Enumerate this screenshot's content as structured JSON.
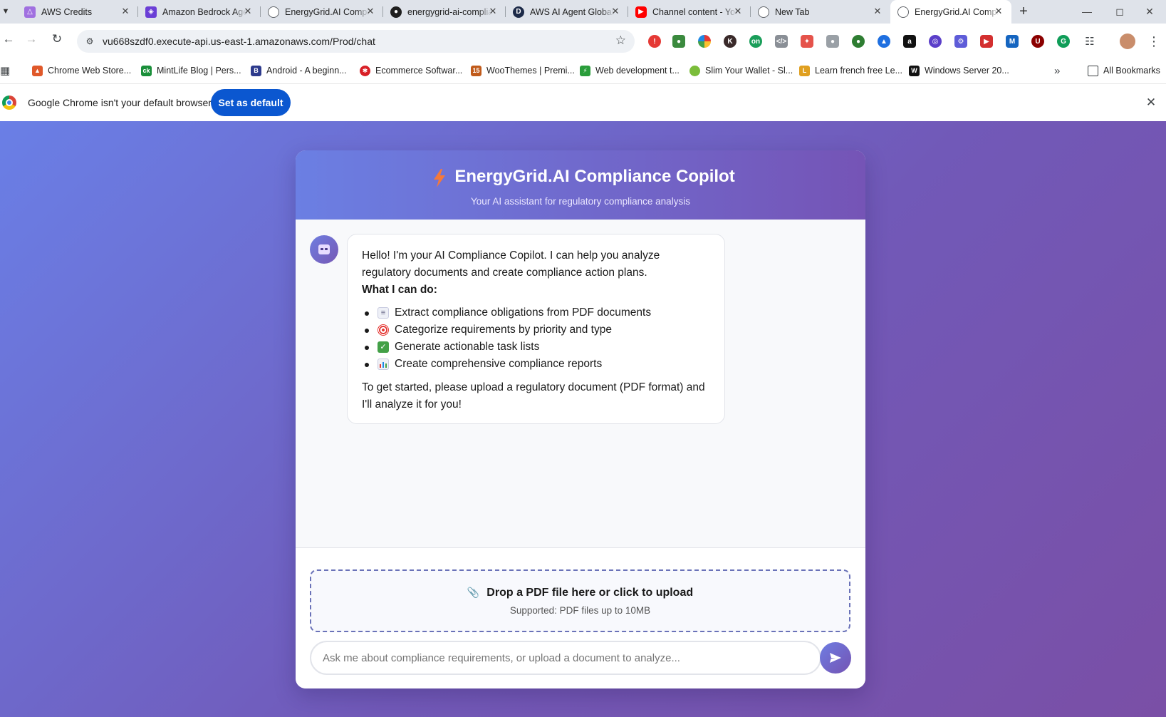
{
  "browser": {
    "tabs": [
      {
        "title": "AWS Credits",
        "favicon": "aws-cube-icon",
        "color": "#a070e0"
      },
      {
        "title": "Amazon Bedrock Agents",
        "favicon": "bedrock-icon",
        "color": "#6b3fd6"
      },
      {
        "title": "EnergyGrid.AI Compliance",
        "favicon": "globe-icon",
        "color": "#5f6368"
      },
      {
        "title": "energygrid-ai-compliance",
        "favicon": "github-icon",
        "color": "#1f1f1f"
      },
      {
        "title": "AWS AI Agent Global",
        "favicon": "d-logo-icon",
        "color": "#1c2a48"
      },
      {
        "title": "Channel content - YouTube",
        "favicon": "youtube-icon",
        "color": "#ff0000"
      },
      {
        "title": "New Tab",
        "favicon": "chrome-icon",
        "color": "#5f6368"
      },
      {
        "title": "EnergyGrid.AI Compliance",
        "favicon": "globe-icon",
        "color": "#5f6368"
      }
    ],
    "active_tab": 7,
    "url": "vu668szdf0.execute-api.us-east-1.amazonaws.com/Prod/chat",
    "bookmarks": [
      {
        "label": "Chrome Web Store...",
        "icon": "webstore-icon",
        "color": "#e0592a"
      },
      {
        "label": "MintLife Blog | Pers...",
        "icon": "ck-icon",
        "color": "#1a8f3a"
      },
      {
        "label": "Android - A beginn...",
        "icon": "b-icon",
        "color": "#2d3a8c"
      },
      {
        "label": "Ecommerce Softwar...",
        "icon": "ecommerce-icon",
        "color": "#d81f26"
      },
      {
        "label": "WooThemes | Premi...",
        "icon": "woo-icon",
        "color": "#c05a1a"
      },
      {
        "label": "Web development t...",
        "icon": "webdev-icon",
        "color": "#2a9d3b"
      },
      {
        "label": "Slim Your Wallet - Sl...",
        "icon": "leaf-icon",
        "color": "#7bbd3a"
      },
      {
        "label": "Learn french free Le...",
        "icon": "lsf-icon",
        "color": "#e0a020"
      },
      {
        "label": "Windows Server 20...",
        "icon": "w-icon",
        "color": "#111111"
      }
    ],
    "all_bookmarks": "All Bookmarks",
    "infobar": {
      "message": "Google Chrome isn't your default browser",
      "button": "Set as default"
    }
  },
  "app": {
    "title": "EnergyGrid.AI Compliance Copilot",
    "subtitle": "Your AI assistant for regulatory compliance analysis",
    "accent": "#7158b8",
    "message": {
      "intro": "Hello! I'm your AI Compliance Copilot. I can help you analyze regulatory documents and create compliance action plans.",
      "heading": "What I can do:",
      "items": [
        {
          "icon": "document-icon",
          "text": "Extract compliance obligations from PDF documents"
        },
        {
          "icon": "target-icon",
          "text": "Categorize requirements by priority and type"
        },
        {
          "icon": "checkmark-icon",
          "text": "Generate actionable task lists"
        },
        {
          "icon": "bar-chart-icon",
          "text": "Create comprehensive compliance reports"
        }
      ],
      "outro": "To get started, please upload a regulatory document (PDF format) and I'll analyze it for you!"
    },
    "upload": {
      "title": "Drop a PDF file here or click to upload",
      "subtitle": "Supported: PDF files up to 10MB"
    },
    "input": {
      "placeholder": "Ask me about compliance requirements, or upload a document to analyze...",
      "value": ""
    }
  }
}
